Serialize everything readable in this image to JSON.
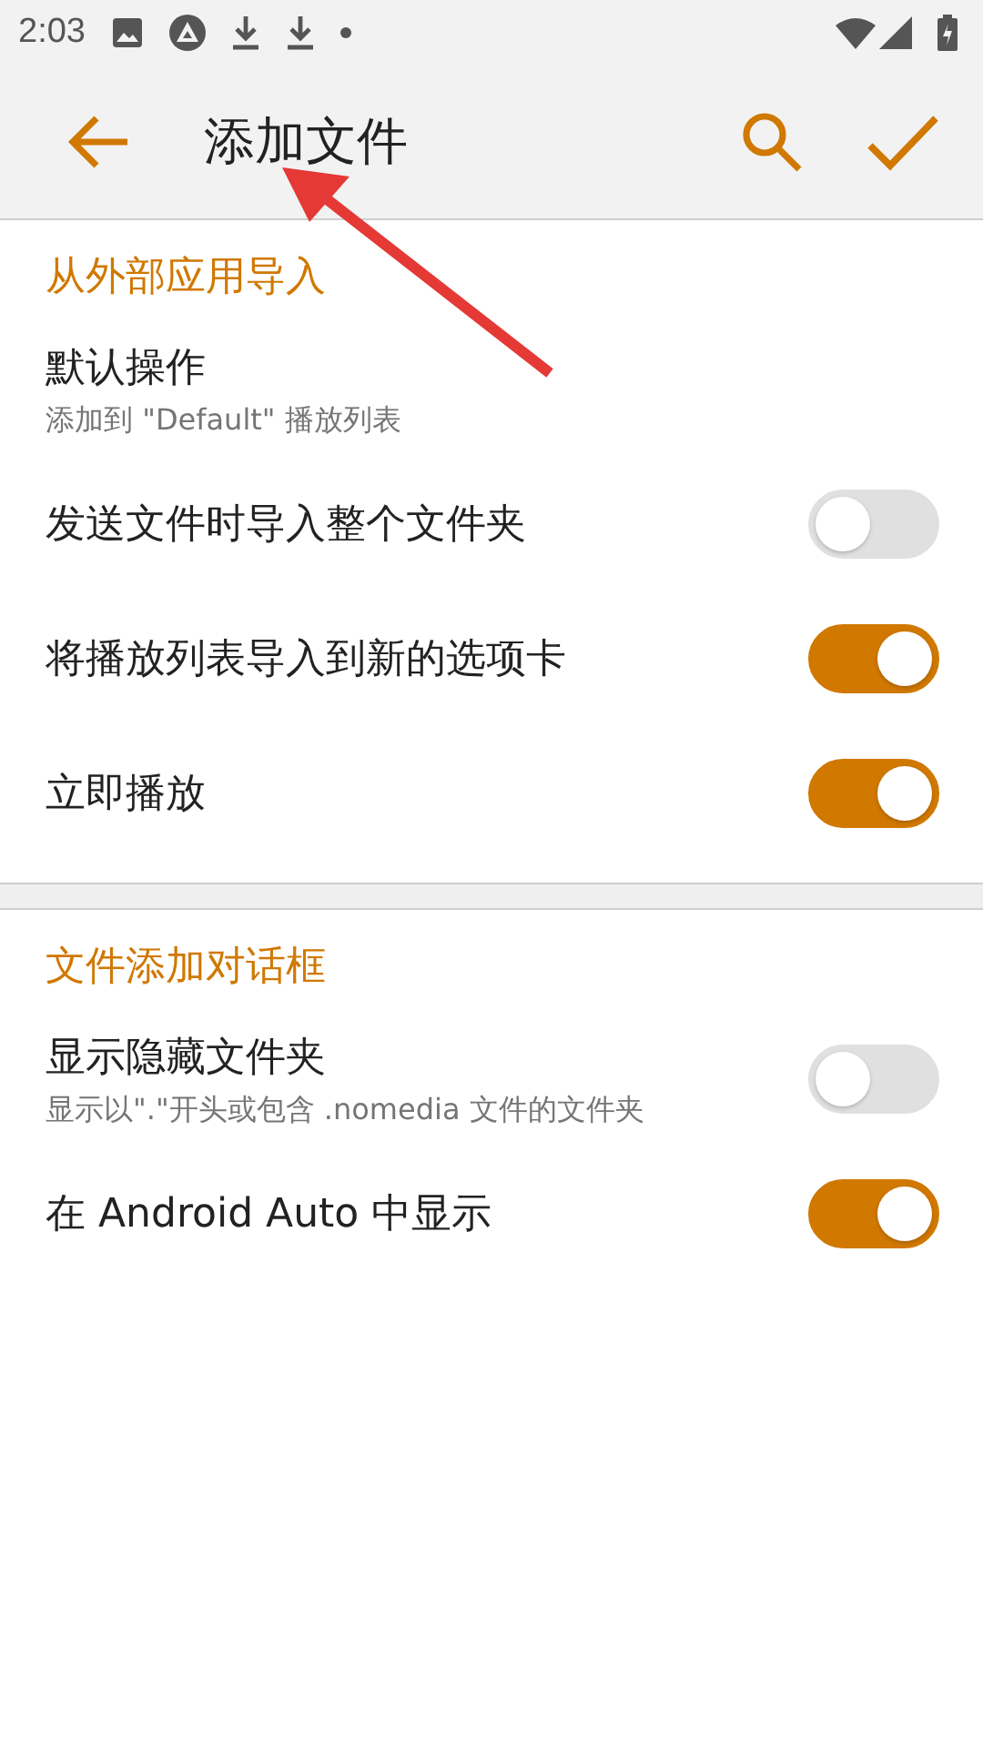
{
  "status_bar": {
    "time": "2:03"
  },
  "toolbar": {
    "title": "添加文件"
  },
  "sections": [
    {
      "title": "从外部应用导入",
      "items": [
        {
          "kind": "plain",
          "label": "默认操作",
          "summary": "添加到 \"Default\" 播放列表"
        },
        {
          "kind": "toggle",
          "label": "发送文件时导入整个文件夹",
          "on": false
        },
        {
          "kind": "toggle",
          "label": "将播放列表导入到新的选项卡",
          "on": true
        },
        {
          "kind": "toggle",
          "label": "立即播放",
          "on": true
        }
      ]
    },
    {
      "title": "文件添加对话框",
      "items": [
        {
          "kind": "toggle",
          "label": "显示隐藏文件夹",
          "summary": "显示以\".\"开头或包含 .nomedia 文件的文件夹",
          "on": false
        },
        {
          "kind": "toggle",
          "label": "在 Android Auto 中显示",
          "on": true
        }
      ]
    }
  ]
}
